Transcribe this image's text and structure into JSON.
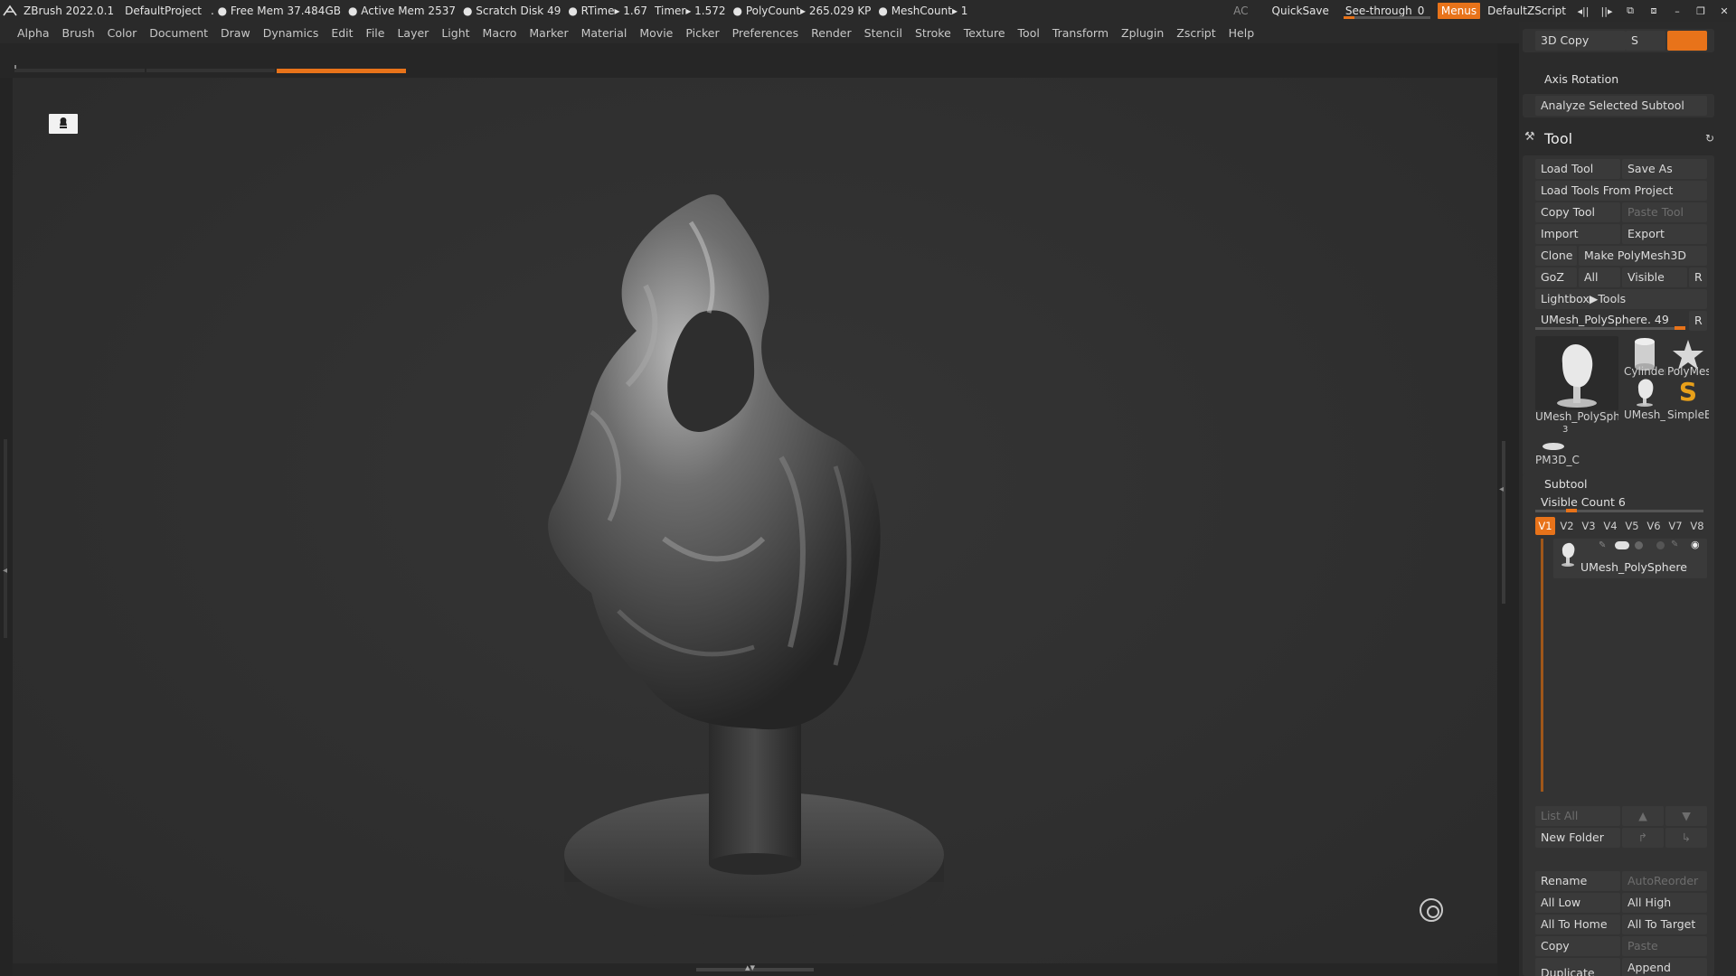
{
  "titlebar": {
    "app_title": "ZBrush 2022.0.1",
    "project": "DefaultProject",
    "free_mem": ". ● Free Mem 37.484GB",
    "active_mem": "● Active Mem 2537",
    "scratch_disk": "● Scratch Disk 49",
    "rtime": "● RTime▸ 1.67",
    "timer": "Timer▸ 1.572",
    "polycount": "● PolyCount▸ 265.029 KP",
    "meshcount": "● MeshCount▸ 1",
    "ac": "AC",
    "quicksave": "QuickSave",
    "see_through_label": "See-through",
    "see_through_value": "0",
    "menus": "Menus",
    "default_script": "DefaultZScript"
  },
  "menubar": [
    "Alpha",
    "Brush",
    "Color",
    "Document",
    "Draw",
    "Dynamics",
    "Edit",
    "File",
    "Layer",
    "Light",
    "Macro",
    "Marker",
    "Material",
    "Movie",
    "Picker",
    "Preferences",
    "Render",
    "Stencil",
    "Stroke",
    "Texture",
    "Tool",
    "Transform",
    "Zplugin",
    "Zscript",
    "Help"
  ],
  "panel": {
    "copy3d": "3D Copy",
    "copy3d_s": "S",
    "axis_rotation": "Axis Rotation",
    "analyze": "Analyze Selected Subtool",
    "tool_title": "Tool",
    "load_tool": "Load Tool",
    "save_as": "Save As",
    "load_from_project": "Load Tools From Project",
    "copy_tool": "Copy Tool",
    "paste_tool": "Paste Tool",
    "import": "Import",
    "export": "Export",
    "clone": "Clone",
    "make_polymesh": "Make PolyMesh3D",
    "goz": "GoZ",
    "all": "All",
    "visible": "Visible",
    "r": "R",
    "lightbox_tools": "Lightbox▶Tools",
    "current_tool": "UMesh_PolySphere. 49",
    "thumbs": {
      "main": "UMesh_PolySphe",
      "cylinder": "Cylinder",
      "polymesh": "PolyMes",
      "umesh_small": "UMesh_",
      "simpleb": "SimpleB",
      "pm3d": "PM3D_C",
      "pm3d_count": "3"
    },
    "subtool_title": "Subtool",
    "visible_count": "Visible Count 6",
    "v_tabs": [
      "V1",
      "V2",
      "V3",
      "V4",
      "V5",
      "V6",
      "V7",
      "V8"
    ],
    "subtool_name": "UMesh_PolySphere",
    "list_all": "List All",
    "new_folder": "New Folder",
    "rename": "Rename",
    "auto_reorder": "AutoReorder",
    "all_low": "All Low",
    "all_high": "All High",
    "all_to_home": "All To Home",
    "all_to_target": "All To Target",
    "copy": "Copy",
    "paste": "Paste",
    "append": "Append",
    "duplicate": "Duplicate"
  },
  "colors": {
    "accent": "#e8731a",
    "panel_bg": "#2b2b2b",
    "canvas_bg": "#303030",
    "button_bg": "#3a3a3a"
  }
}
